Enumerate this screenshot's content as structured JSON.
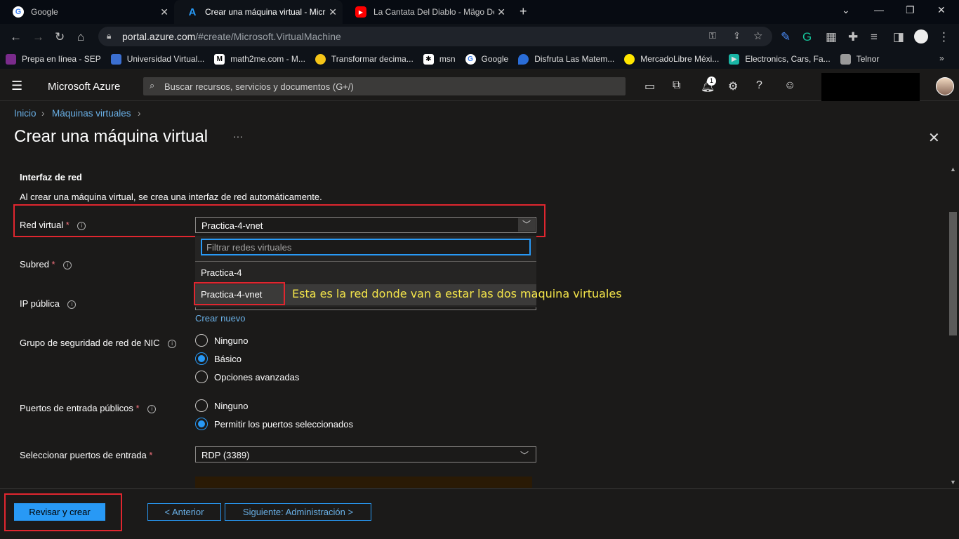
{
  "browser": {
    "tabs": [
      {
        "label": "Google",
        "icon": "google-icon"
      },
      {
        "label": "Crear una máquina virtual - Micr",
        "icon": "azure-icon"
      },
      {
        "label": "La Cantata Del Diablo - Mägo De",
        "icon": "youtube-icon"
      }
    ],
    "url_host": "portal.azure.com",
    "url_path": "/#create/Microsoft.VirtualMachine",
    "bookmarks": [
      "Prepa en línea - SEP",
      "Universidad Virtual...",
      "math2me.com - M...",
      "Transformar decima...",
      "msn",
      "Google",
      "Disfruta Las Matem...",
      "MercadoLibre Méxi...",
      "Electronics, Cars, Fa...",
      "Telnor"
    ]
  },
  "portal": {
    "brand": "Microsoft Azure",
    "search_placeholder": "Buscar recursos, servicios y documentos (G+/)",
    "notification_count": "1"
  },
  "breadcrumb": [
    "Inicio",
    "Máquinas virtuales"
  ],
  "page_title": "Crear una máquina virtual",
  "more_label": "···",
  "section": {
    "heading": "Interfaz de red",
    "description": "Al crear una máquina virtual, se crea una interfaz de red automáticamente."
  },
  "fields": {
    "red_virtual_label": "Red virtual",
    "red_virtual_value": "Practica-4-vnet",
    "subred_label": "Subred",
    "ip_label": "IP pública",
    "crear_nuevo": "Crear nuevo",
    "nsg_label": "Grupo de seguridad de red de NIC",
    "nsg_options": [
      "Ninguno",
      "Básico",
      "Opciones avanzadas"
    ],
    "ports_label": "Puertos de entrada públicos",
    "ports_options": [
      "Ninguno",
      "Permitir los puertos seleccionados"
    ],
    "select_ports_label": "Seleccionar puertos de entrada",
    "select_ports_value": "RDP (3389)",
    "required_mark": "*"
  },
  "dropdown": {
    "filter_placeholder": "Filtrar redes virtuales",
    "options": [
      "Practica-4",
      "Practica-4-vnet"
    ]
  },
  "annotation": "Esta es la red donde van a estar las dos maquina virtuales",
  "footer": {
    "review_button": "Revisar y crear",
    "prev_button": "< Anterior",
    "next_button": "Siguiente: Administración >"
  }
}
